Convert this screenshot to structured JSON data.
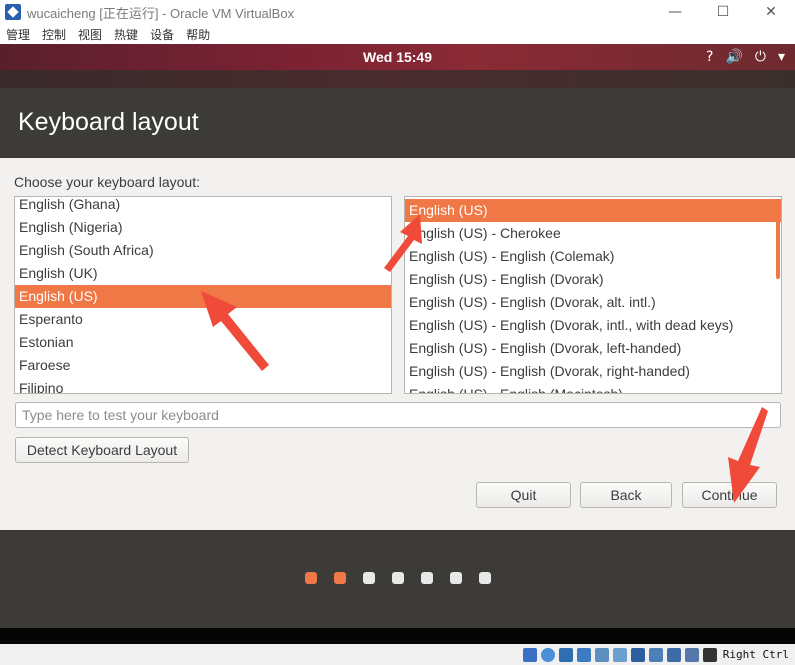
{
  "window": {
    "title": "wucaicheng [正在运行] - Oracle VM VirtualBox",
    "controls": {
      "minimize": "—",
      "maximize": "☐",
      "close": "✕"
    }
  },
  "menu": {
    "items": [
      "管理",
      "控制",
      "视图",
      "热键",
      "设备",
      "帮助"
    ]
  },
  "panel": {
    "clock": "Wed 15:49",
    "tray": {
      "accessibility": "?",
      "sound": "🔊",
      "power": "⏻",
      "dropdown": "▾"
    }
  },
  "installer": {
    "title": "Keyboard layout",
    "choose_label": "Choose your keyboard layout:",
    "layouts": [
      {
        "label": "English (Ghana)",
        "selected": false
      },
      {
        "label": "English (Nigeria)",
        "selected": false
      },
      {
        "label": "English (South Africa)",
        "selected": false
      },
      {
        "label": "English (UK)",
        "selected": false
      },
      {
        "label": "English (US)",
        "selected": true
      },
      {
        "label": "Esperanto",
        "selected": false
      },
      {
        "label": "Estonian",
        "selected": false
      },
      {
        "label": "Faroese",
        "selected": false
      },
      {
        "label": "Filipino",
        "selected": false
      }
    ],
    "variants": [
      {
        "label": "English (US)",
        "selected": true
      },
      {
        "label": "English (US) - Cherokee",
        "selected": false
      },
      {
        "label": "English (US) - English (Colemak)",
        "selected": false
      },
      {
        "label": "English (US) - English (Dvorak)",
        "selected": false
      },
      {
        "label": "English (US) - English (Dvorak, alt. intl.)",
        "selected": false
      },
      {
        "label": "English (US) - English (Dvorak, intl., with dead keys)",
        "selected": false
      },
      {
        "label": "English (US) - English (Dvorak, left-handed)",
        "selected": false
      },
      {
        "label": "English (US) - English (Dvorak, right-handed)",
        "selected": false
      },
      {
        "label": "English (US) - English (Macintosh)",
        "selected": false
      }
    ],
    "test_input": {
      "placeholder": "Type here to test your keyboard",
      "value": ""
    },
    "buttons": {
      "detect": "Detect Keyboard Layout",
      "quit": "Quit",
      "back": "Back",
      "continue": "Continue"
    }
  },
  "slideshow": {
    "dots_total": 7,
    "dots_active": [
      0,
      1
    ]
  },
  "statusbar": {
    "host_key": "Right Ctrl"
  },
  "colors": {
    "accent": "#f07746",
    "header_bg": "#3c3b37",
    "body_bg": "#f2f1f0",
    "annotation": "#f04a3a"
  }
}
